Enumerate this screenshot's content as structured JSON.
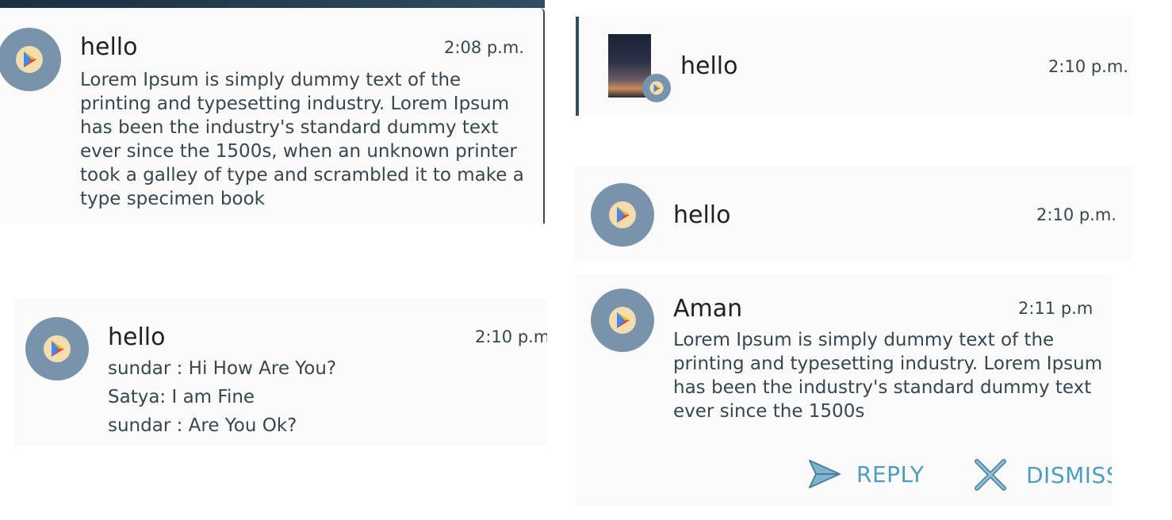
{
  "notifications": {
    "n1": {
      "title": "hello",
      "time": "2:08 p.m.",
      "body": "Lorem Ipsum is simply dummy text of the printing and typesetting industry. Lorem Ipsum has been the industry's standard dummy text ever since the 1500s, when an unknown printer took a galley of type and scrambled it to make a type specimen book"
    },
    "n2": {
      "title": "hello",
      "time": "2:10 p.m",
      "messages": [
        "sundar : Hi How Are You?",
        "Satya: I am Fine",
        "sundar : Are You Ok?"
      ]
    },
    "n3": {
      "title": "hello",
      "time": "2:10 p.m."
    },
    "n4": {
      "title": "hello",
      "time": "2:10 p.m."
    },
    "n5": {
      "title": "Aman",
      "time": "2:11 p.m",
      "body": "Lorem Ipsum is simply dummy text of the printing and typesetting industry. Lorem Ipsum has been the industry's standard dummy text ever since the 1500s",
      "actions": {
        "reply_label": "REPLY",
        "dismiss_label": "DISMISS"
      }
    }
  },
  "icons": {
    "app_icon": "play-store-icon",
    "reply_icon": "send-icon",
    "dismiss_icon": "close-icon"
  },
  "colors": {
    "card_background": "#fafafa",
    "avatar_background": "#7893aa",
    "action_text": "#4e9dbd"
  }
}
